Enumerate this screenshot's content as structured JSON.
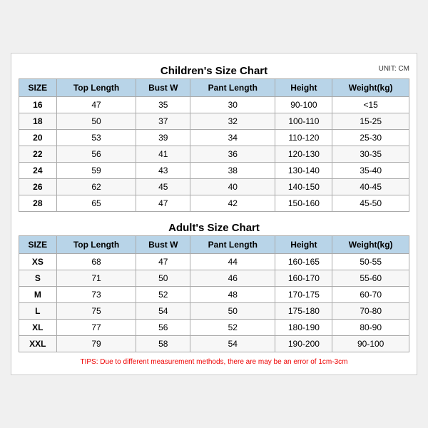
{
  "children_title": "Children's Size Chart",
  "adults_title": "Adult's Size Chart",
  "unit": "UNIT: CM",
  "tips": "TIPS: Due to different measurement methods, there are may be an error of 1cm-3cm",
  "columns": [
    "SIZE",
    "Top Length",
    "Bust W",
    "Pant Length",
    "Height",
    "Weight(kg)"
  ],
  "children_rows": [
    [
      "16",
      "47",
      "35",
      "30",
      "90-100",
      "<15"
    ],
    [
      "18",
      "50",
      "37",
      "32",
      "100-110",
      "15-25"
    ],
    [
      "20",
      "53",
      "39",
      "34",
      "110-120",
      "25-30"
    ],
    [
      "22",
      "56",
      "41",
      "36",
      "120-130",
      "30-35"
    ],
    [
      "24",
      "59",
      "43",
      "38",
      "130-140",
      "35-40"
    ],
    [
      "26",
      "62",
      "45",
      "40",
      "140-150",
      "40-45"
    ],
    [
      "28",
      "65",
      "47",
      "42",
      "150-160",
      "45-50"
    ]
  ],
  "adults_rows": [
    [
      "XS",
      "68",
      "47",
      "44",
      "160-165",
      "50-55"
    ],
    [
      "S",
      "71",
      "50",
      "46",
      "160-170",
      "55-60"
    ],
    [
      "M",
      "73",
      "52",
      "48",
      "170-175",
      "60-70"
    ],
    [
      "L",
      "75",
      "54",
      "50",
      "175-180",
      "70-80"
    ],
    [
      "XL",
      "77",
      "56",
      "52",
      "180-190",
      "80-90"
    ],
    [
      "XXL",
      "79",
      "58",
      "54",
      "190-200",
      "90-100"
    ]
  ]
}
